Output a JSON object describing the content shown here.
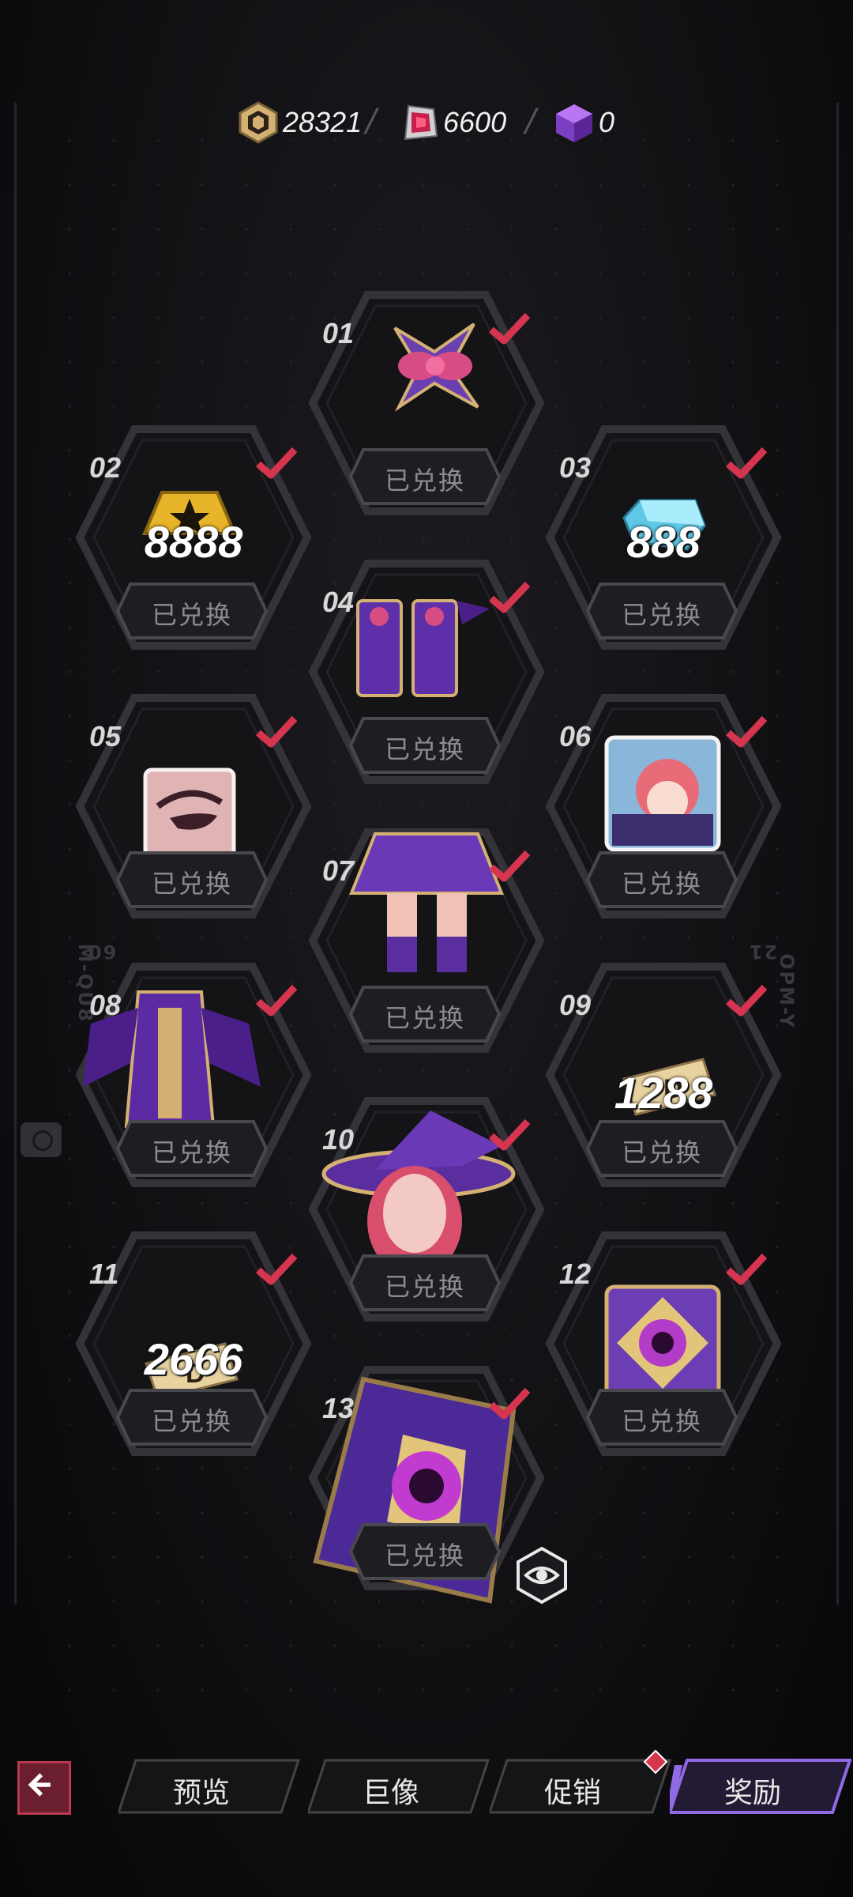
{
  "currency": {
    "gold": {
      "icon": "gold-token-icon",
      "value": "28321"
    },
    "gem": {
      "icon": "red-gem-icon",
      "value": "6600"
    },
    "cube": {
      "icon": "purple-cube-icon",
      "value": "0"
    }
  },
  "side_text": {
    "left": "M-QU8",
    "right": "OPM-Y",
    "left_code": "60",
    "right_code": "21"
  },
  "redeemed_label": "已兑换",
  "rewards": [
    {
      "num": "01",
      "item": "bow-hair-accessory-icon",
      "amount": ""
    },
    {
      "num": "02",
      "item": "gold-star-token-icon",
      "amount": "8888"
    },
    {
      "num": "03",
      "item": "blue-crystal-icon",
      "amount": "888"
    },
    {
      "num": "04",
      "item": "purple-boots-icon",
      "amount": ""
    },
    {
      "num": "05",
      "item": "eye-makeup-icon",
      "amount": ""
    },
    {
      "num": "06",
      "item": "avatar-portrait-icon",
      "amount": ""
    },
    {
      "num": "07",
      "item": "purple-skirt-icon",
      "amount": ""
    },
    {
      "num": "08",
      "item": "purple-dress-top-icon",
      "amount": ""
    },
    {
      "num": "09",
      "item": "d-ticket-icon",
      "amount": "1288"
    },
    {
      "num": "10",
      "item": "witch-hat-hair-icon",
      "amount": ""
    },
    {
      "num": "11",
      "item": "d-ticket-icon",
      "amount": "2666"
    },
    {
      "num": "12",
      "item": "magic-card-frame-icon",
      "amount": ""
    },
    {
      "num": "13",
      "item": "spellbook-icon",
      "amount": ""
    }
  ],
  "nav": {
    "back": "back-arrow-icon",
    "tabs": [
      "预览",
      "巨像",
      "促销",
      "奖励"
    ],
    "active": "奖励"
  },
  "colors": {
    "accent": "#7b4fd6",
    "check": "#d6354f",
    "panel": "#18171b"
  }
}
